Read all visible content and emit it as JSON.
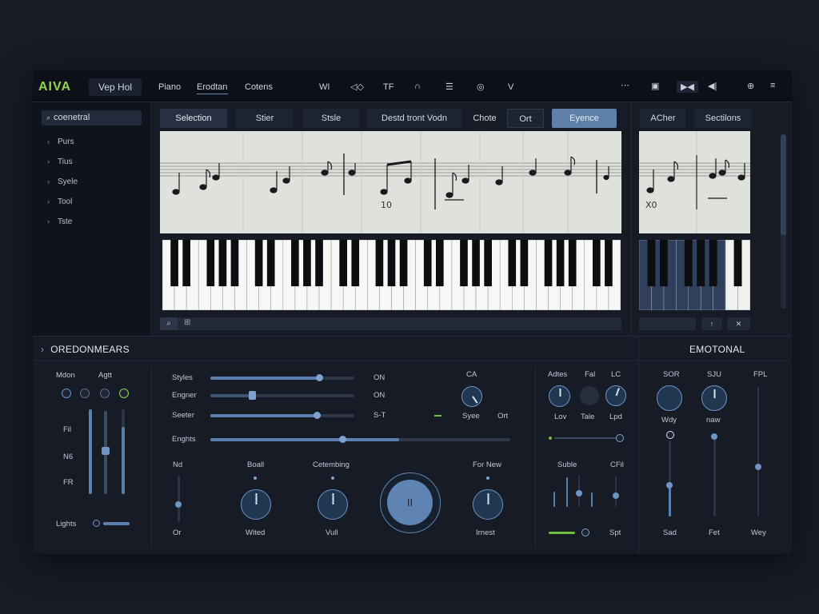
{
  "app": {
    "logo": "AIVA",
    "project": "Vep Hol"
  },
  "menu": [
    "Piano",
    "Erodtan",
    "Cotens"
  ],
  "toolbar": {
    "t1": "WI",
    "t2": "◁◇",
    "t3": "TF",
    "t4": "∩",
    "t5": "☰",
    "t6": "◎",
    "t7": "V",
    "r1": "⋯",
    "r2": "▣",
    "r3": "▶◀",
    "r4": "◀|",
    "r5": "⊕",
    "r6": "≡"
  },
  "sidebar": {
    "search": "coenetral",
    "items": [
      "Purs",
      "Tius",
      "Syele",
      "Tool",
      "Tste"
    ]
  },
  "tabs": {
    "selection": "Selection",
    "stier": "Stier",
    "style": "Stsle",
    "dest": "Destd tront Vodn",
    "chote": "Chote",
    "ort": "Ort",
    "eyence": "Eyence",
    "acher": "ACher",
    "sections": "Sectilons"
  },
  "score": {
    "n1": "10",
    "n2": "X0"
  },
  "panels": {
    "left_title": "OREDONMEARS",
    "right_title": "EMOTONAL"
  },
  "mixer": {
    "mdon": "Mdon",
    "agtt": "Agtt",
    "fil": "Fil",
    "no": "N6",
    "fr": "FR",
    "lights": "Lights"
  },
  "center": {
    "styles": "Styles",
    "on1": "ON",
    "engner": "Engner",
    "on2": "ON",
    "seeter": "Seeter",
    "s5t": "S-T",
    "enghts": "Enghts",
    "ca": "CA",
    "syee": "Syee",
    "ort": "Ort",
    "nd": "Nd",
    "or": "Or",
    "boall": "Boall",
    "wited": "Wited",
    "cotembing": "Cetembing",
    "vull": "Vull",
    "play": "II",
    "fornew": "For New",
    "irnest": "Irnest"
  },
  "fx": {
    "adtes": "Adtes",
    "fal": "Fal",
    "lc": "LC",
    "lov": "Lov",
    "tale": "Tale",
    "lpd": "Lpd",
    "suble": "Suble",
    "cfil": "CFil",
    "spt": "Spt"
  },
  "emotional": {
    "sor": "SOR",
    "sju": "SJU",
    "fpl": "FPL",
    "wdy": "Wdy",
    "naw": "naw",
    "sad": "Sad",
    "fet": "Fet",
    "wey": "Wey"
  },
  "colors": {
    "accent": "#5e7fa8",
    "green": "#8fd34e",
    "bg": "#161b25"
  }
}
